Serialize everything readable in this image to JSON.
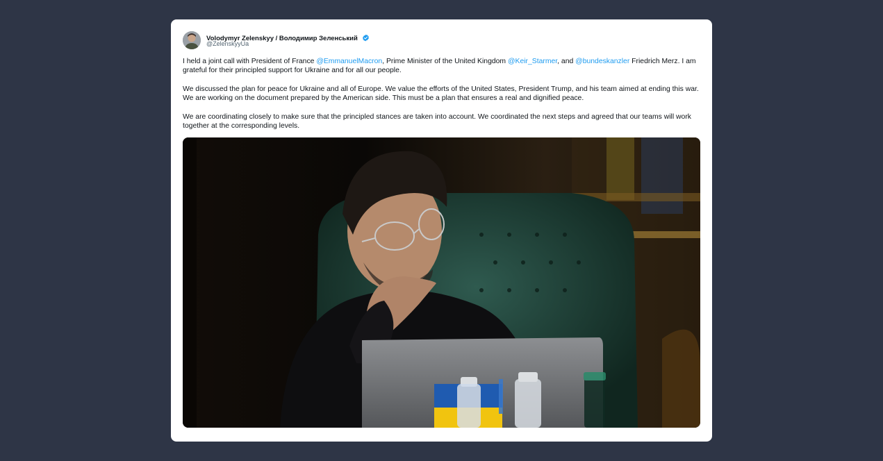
{
  "tweet": {
    "display_name": "Volodymyr Zelenskyy / Володимир Зеленський",
    "handle": "@ZelenskyyUa",
    "verified_icon": "verified-badge-icon",
    "paragraph1": {
      "t1": "I held a joint call with President of France ",
      "m1": "@EmmanuelMacron",
      "t2": ", Prime Minister of the United Kingdom ",
      "m2": "@Keir_Starmer",
      "t3": ", and ",
      "m3": "@bundeskanzler",
      "t4": " Friedrich Merz. I am grateful for their principled support for Ukraine and for all our people."
    },
    "paragraph2": "We discussed the plan for peace for Ukraine and all of Europe. We value the efforts of the United States, President Trump, and his team aimed at ending this war. We are working on the document prepared by the American side. This must be a plan that ensures a real and dignified peace.",
    "paragraph3": "We are coordinating closely to make sure that the principled stances are taken into account. We coordinated the next steps and agreed that our teams will work together at the corresponding levels."
  },
  "colors": {
    "background": "#2e3546",
    "card": "#ffffff",
    "mention": "#1d9bf0",
    "verified": "#1d9bf0",
    "text": "#0f1419",
    "handle": "#536471"
  }
}
